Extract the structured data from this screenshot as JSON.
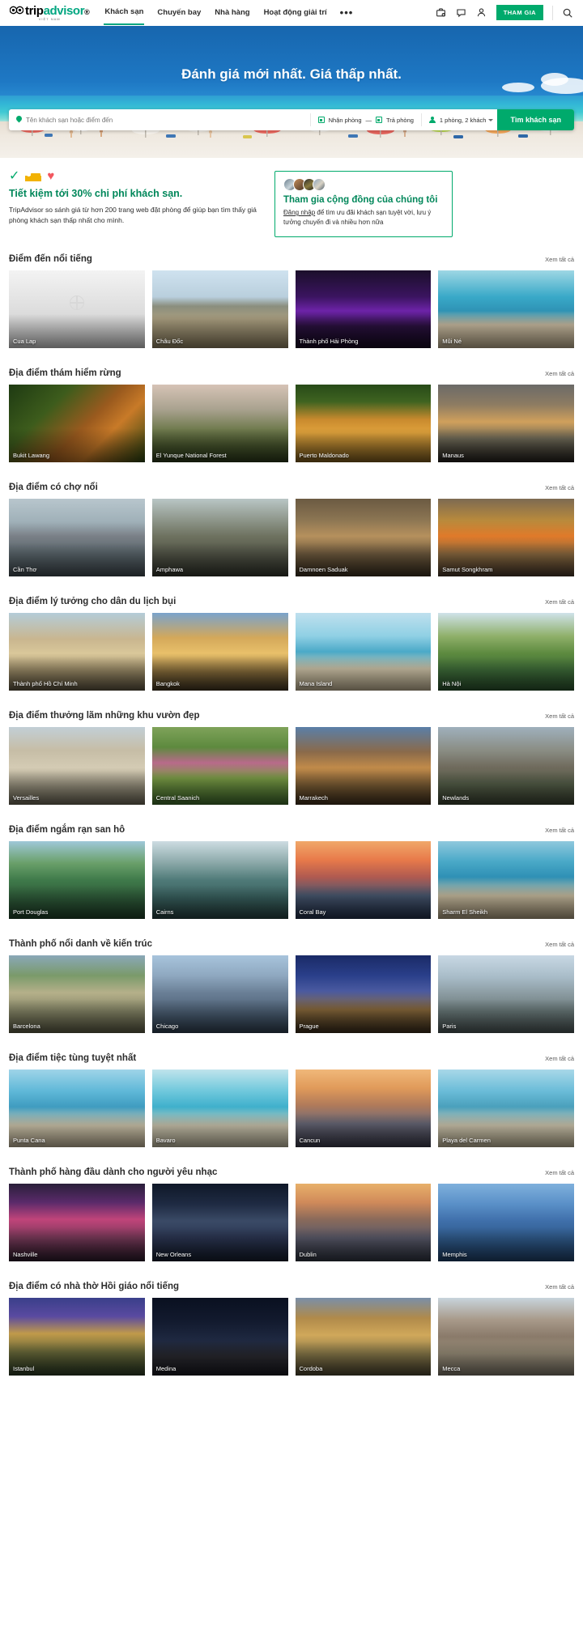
{
  "header": {
    "logo": {
      "trip": "trip",
      "advisor": "advisor",
      "dot": "®",
      "sub": "VIỆT NAM"
    },
    "nav": [
      {
        "label": "Khách sạn",
        "active": true
      },
      {
        "label": "Chuyến bay",
        "active": false
      },
      {
        "label": "Nhà hàng",
        "active": false
      },
      {
        "label": "Hoạt động giải trí",
        "active": false
      }
    ],
    "more_label": "•••",
    "icons": [
      "trips-briefcase-icon",
      "chat-bubble-icon",
      "user-profile-icon",
      "search-icon"
    ],
    "join_label": "THAM GIA"
  },
  "hero": {
    "title": "Đánh giá mới nhất. Giá thấp nhất.",
    "search": {
      "destination_placeholder": "Tên khách sạn hoặc điểm đến",
      "dates_label": "Nhận phòng — Trả phòng",
      "checkin_label": "Nhận phòng",
      "dash": "—",
      "checkout_label": "Trả phòng",
      "guests_label": "1 phòng, 2 khách",
      "submit_label": "Tìm khách sạn"
    }
  },
  "value_prop": {
    "title": "Tiết kiệm tới 30% chi phí khách sạn.",
    "body": "TripAdvisor so sánh giá từ hơn 200 trang web đặt phòng để giúp bạn tìm thấy  giá phòng khách sạn thấp nhất cho mình.",
    "community": {
      "title": "Tham gia cộng đồng của chúng tôi",
      "link_text": "Đăng nhập",
      "body_rest": " để tìm ưu đãi khách sạn tuyệt vời, lưu ý tưởng chuyến đi và nhiều hơn nữa"
    }
  },
  "see_all_label": "Xem tất cả",
  "sections": [
    {
      "title": "Điểm đến nổi tiếng",
      "cards": [
        {
          "label": "Cua Lap",
          "style": "placeholder"
        },
        {
          "label": "Châu Đốc",
          "style": "boat-river"
        },
        {
          "label": "Thành phố Hải Phòng",
          "style": "night-purple"
        },
        {
          "label": "Mũi Né",
          "style": "beach-blue"
        }
      ]
    },
    {
      "title": "Địa điểm thám hiểm rừng",
      "cards": [
        {
          "label": "Bukit Lawang",
          "style": "jungle-orangutan"
        },
        {
          "label": "El Yunque National Forest",
          "style": "misty-mountain"
        },
        {
          "label": "Puerto Maldonado",
          "style": "jungle-huts"
        },
        {
          "label": "Manaus",
          "style": "river-sunset"
        }
      ]
    },
    {
      "title": "Địa điểm có chợ nổi",
      "cards": [
        {
          "label": "Cần Thơ",
          "style": "harbor-boats"
        },
        {
          "label": "Amphawa",
          "style": "canal-boats"
        },
        {
          "label": "Damnoen Saduak",
          "style": "market-stall"
        },
        {
          "label": "Samut Songkhram",
          "style": "train-market"
        }
      ]
    },
    {
      "title": "Địa điểm lý tưởng cho dân du lịch bụi",
      "cards": [
        {
          "label": "Thành phố Hồ Chí Minh",
          "style": "colonial-building"
        },
        {
          "label": "Bangkok",
          "style": "golden-temple"
        },
        {
          "label": "Mana Island",
          "style": "palm-beach"
        },
        {
          "label": "Hà Nội",
          "style": "green-lake"
        }
      ]
    },
    {
      "title": "Địa điểm thưởng lãm những khu vườn đẹp",
      "cards": [
        {
          "label": "Versailles",
          "style": "palace-colonnade"
        },
        {
          "label": "Central Saanich",
          "style": "flower-garden"
        },
        {
          "label": "Marrakech",
          "style": "koutoubia"
        },
        {
          "label": "Newlands",
          "style": "stone-ruin"
        }
      ]
    },
    {
      "title": "Địa điểm ngắm rạn san hô",
      "cards": [
        {
          "label": "Port Douglas",
          "style": "tropical-coast"
        },
        {
          "label": "Cairns",
          "style": "island-sea"
        },
        {
          "label": "Coral Bay",
          "style": "ocean-sunset"
        },
        {
          "label": "Sharm El Sheikh",
          "style": "resort-bay"
        }
      ]
    },
    {
      "title": "Thành phố nổi danh về kiến trúc",
      "cards": [
        {
          "label": "Barcelona",
          "style": "gaudi-mosaic"
        },
        {
          "label": "Chicago",
          "style": "skyline-river"
        },
        {
          "label": "Prague",
          "style": "tyn-church"
        },
        {
          "label": "Paris",
          "style": "eiffel-tower"
        }
      ]
    },
    {
      "title": "Địa điểm tiệc tùng tuyệt nhất",
      "cards": [
        {
          "label": "Punta Cana",
          "style": "palm-beach2"
        },
        {
          "label": "Bavaro",
          "style": "turquoise-shore"
        },
        {
          "label": "Cancun",
          "style": "pier-sunset"
        },
        {
          "label": "Playa del Carmen",
          "style": "beach-palms"
        }
      ]
    },
    {
      "title": "Thành phố hàng đầu dành cho người yêu nhạc",
      "cards": [
        {
          "label": "Nashville",
          "style": "neon-street"
        },
        {
          "label": "New Orleans",
          "style": "cathedral-night"
        },
        {
          "label": "Dublin",
          "style": "river-dusk"
        },
        {
          "label": "Memphis",
          "style": "blue-pyramid"
        }
      ]
    },
    {
      "title": "Địa điểm có nhà thờ Hồi giáo nổi tiếng",
      "cards": [
        {
          "label": "Istanbul",
          "style": "hagia-sophia"
        },
        {
          "label": "Medina",
          "style": "desert-night"
        },
        {
          "label": "Cordoba",
          "style": "stone-arch"
        },
        {
          "label": "Mecca",
          "style": "rocky-hills"
        }
      ]
    }
  ]
}
